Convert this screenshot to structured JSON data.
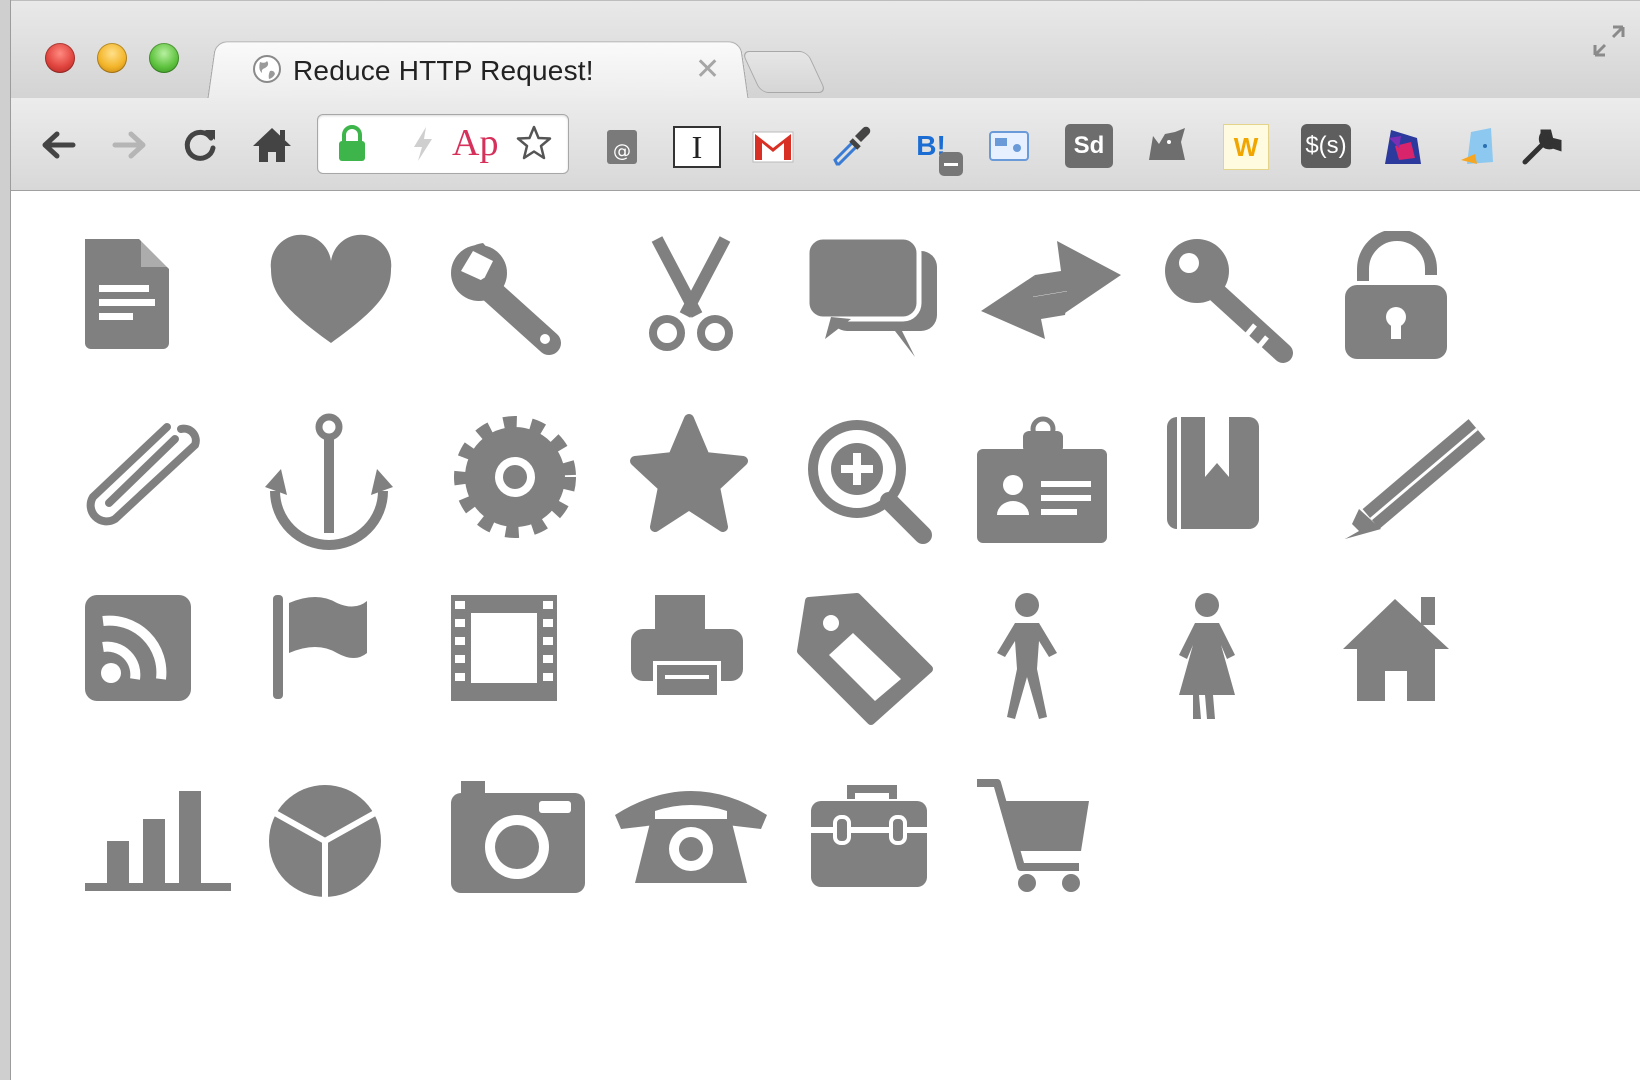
{
  "window": {
    "tab": {
      "title": "Reduce HTTP Request!",
      "close_label": "✕"
    }
  },
  "toolbar": {
    "extensions": {
      "blogger_label": "B!",
      "sd_label": "Sd",
      "w_label": "W",
      "dollar_label": "$(s)",
      "i_label": "I",
      "ap_label": "Ap"
    }
  },
  "colors": {
    "icon_gray": "#808080",
    "gmail_red": "#d93025",
    "lock_green": "#3db54a"
  },
  "icons": [
    "document-icon",
    "heart-icon",
    "wrench-icon",
    "scissors-icon",
    "chat-bubbles-icon",
    "swap-arrows-icon",
    "key-icon",
    "unlock-icon",
    "paperclip-icon",
    "anchor-icon",
    "gear-icon",
    "star-icon",
    "zoom-in-icon",
    "id-badge-icon",
    "bookmark-book-icon",
    "pencil-icon",
    "rss-icon",
    "flag-icon",
    "film-icon",
    "printer-icon",
    "tag-icon",
    "man-icon",
    "woman-icon",
    "house-icon",
    "bar-chart-icon",
    "pie-chart-icon",
    "camera-icon",
    "telephone-icon",
    "toolbox-icon",
    "shopping-cart-icon"
  ]
}
